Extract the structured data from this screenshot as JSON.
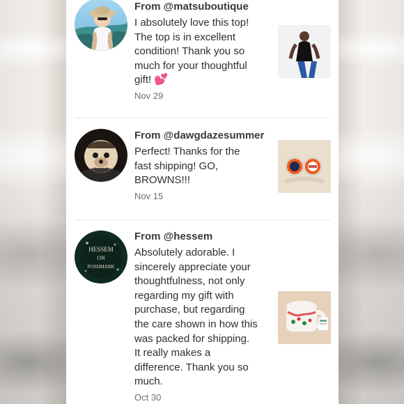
{
  "feedback": [
    {
      "from": "From @matsuboutique",
      "message_lines": [
        "I absolutely love this top!",
        "The top is in excellent",
        "condition! Thank you so",
        "much for your thoughtful",
        "gift! "
      ],
      "emoji": "💕",
      "date": "Nov 29",
      "avatar_icon": "user-avatar-hat-icon",
      "thumb_icon": "clothing-photo-icon"
    },
    {
      "from": "From @dawgdazesummer",
      "message_lines": [
        "Perfect! Thanks for the",
        "fast shipping! GO,",
        "BROWNS!!!"
      ],
      "date": "Nov 15",
      "avatar_icon": "dog-avatar-icon",
      "thumb_icon": "buttons-photo-icon"
    },
    {
      "from": "From @hessem",
      "message_lines": [
        "Absolutely adorable. I",
        "sincerely appreciate your",
        "thoughtfulness, not only",
        "regarding my gift with",
        "purchase, but regarding",
        "the care shown in how this",
        "was packed for shipping.",
        "It really makes a",
        "difference. Thank you so",
        "much."
      ],
      "date": "Oct 30",
      "avatar_text": "HESSEM ON POSHMARK",
      "avatar_icon": "shop-logo-avatar-icon",
      "thumb_icon": "mug-photo-icon"
    }
  ],
  "colors": {
    "panel": "#ffffff",
    "text": "#2f2f2f",
    "muted": "#6d6d6d",
    "divider": "#e7e7e7",
    "heart": "#e84393"
  }
}
